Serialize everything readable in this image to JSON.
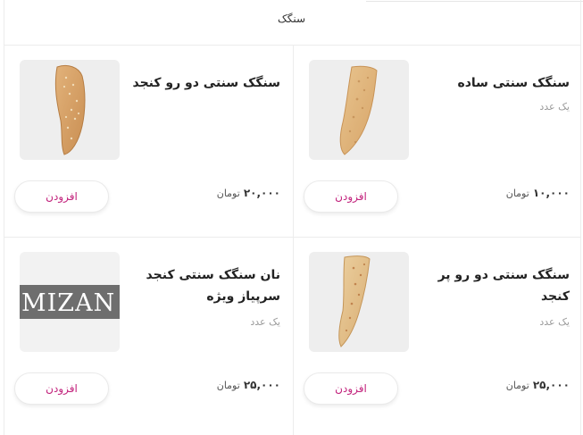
{
  "category": {
    "title": "سنگک"
  },
  "products": [
    {
      "name": "سنگک سنتی ساده",
      "unit": "یک عدد",
      "price": "۱۰,۰۰۰",
      "currency": "تومان",
      "add_label": "افزودن",
      "image": "bread-image"
    },
    {
      "name": "سنگک سنتی دو رو کنجد",
      "unit": "",
      "price": "۲۰,۰۰۰",
      "currency": "تومان",
      "add_label": "افزودن",
      "image": "bread-image"
    },
    {
      "name": "سنگک سنتی دو رو پر کنجد",
      "unit": "یک عدد",
      "price": "۲۵,۰۰۰",
      "currency": "تومان",
      "add_label": "افزودن",
      "image": "bread-image"
    },
    {
      "name": "نان سنگک سنتی کنجد سرپیاز ویژه",
      "unit": "یک عدد",
      "price": "۲۵,۰۰۰",
      "currency": "تومان",
      "add_label": "افزودن",
      "image": "watermark-image",
      "watermark": "MIZAN"
    }
  ],
  "colors": {
    "accent": "#c2227c",
    "divider": "#ececec",
    "thumb_bg": "#eeeeee"
  }
}
